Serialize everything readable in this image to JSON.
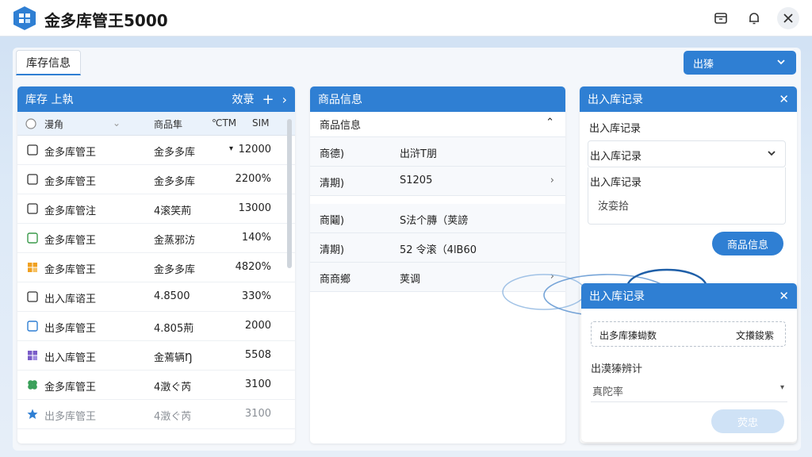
{
  "app": {
    "title": "金多库管王5000",
    "accent_color": "#2f7fd3"
  },
  "titlebar": {
    "icons": [
      "box-icon",
      "bell-icon",
      "close-icon"
    ]
  },
  "top": {
    "tab_label": "库存信息",
    "out_button_label": "出獉"
  },
  "inventory": {
    "header_title": "库存 上執",
    "header_action": "效菉",
    "col_filter": "漫角",
    "col_store": "商品隼",
    "col_a": "℃TM",
    "col_b": "SⅠM",
    "rows": [
      {
        "icon": "checkbox-icon",
        "name": "金多库管王",
        "store": "金多多库",
        "qty": "12000",
        "caret": "▾"
      },
      {
        "icon": "checkbox-icon",
        "name": "金多库管王",
        "store": "金多多库",
        "qty": "2200%",
        "caret": ""
      },
      {
        "icon": "checkbox-icon",
        "name": "金多库管注",
        "store": "4滚笑荊",
        "qty": "13000",
        "caret": ""
      },
      {
        "icon": "checkbox-green-icon",
        "name": "金多库管王",
        "store": "金蒸邪汸",
        "qty": "140%",
        "caret": ""
      },
      {
        "icon": "grid-orange-icon",
        "name": "金多库管王",
        "store": "金多多库",
        "qty": "4820%",
        "caret": ""
      },
      {
        "icon": "checkbox-icon",
        "name": "出入库谘王",
        "store": "4.8500",
        "qty": "330%",
        "caret": ""
      },
      {
        "icon": "checkbox-blue-icon",
        "name": "出多库管王",
        "store": "4.805荊",
        "qty": "2000",
        "caret": ""
      },
      {
        "icon": "grid-purple-icon",
        "name": "出入库管王",
        "store": "金蔫辆Ŋ",
        "qty": "5508",
        "caret": ""
      },
      {
        "icon": "clover-green-icon",
        "name": "金多库管王",
        "store": "4澂ぐ芮",
        "qty": "3100",
        "caret": ""
      },
      {
        "icon": "star-blue-icon",
        "name": "出多库管王",
        "store": "4澂ぐ芮",
        "qty": "3100",
        "caret": ""
      }
    ]
  },
  "product": {
    "header_title": "商品信息",
    "sub_title": "商品信息",
    "rows": [
      {
        "key": "商德)",
        "value": "出浒T朋",
        "arrow": ""
      },
      {
        "key": "清期)",
        "value": "S1205",
        "arrow": "›"
      },
      {
        "key": "商鬮)",
        "value": "S法个膞（荚謗",
        "arrow": ""
      },
      {
        "key": "清期)",
        "value": "52  令滚（4lB60",
        "arrow": ""
      },
      {
        "key": "商商鄉",
        "value": "荚调",
        "arrow": "›"
      }
    ]
  },
  "records": {
    "header_title": "出入库记录",
    "line1": "出入库记录",
    "select_value": "出入库记录",
    "line3": "出入库记录",
    "line4": "汝娈拾",
    "button_label": "商品信息"
  },
  "float": {
    "header_title": "出入库记录",
    "box_left": "出多库獉蜐数",
    "box_right": "文攁鋑紫",
    "label": "出漠獉辨计",
    "select_value": "真陀率",
    "button_label": "荧忠"
  }
}
